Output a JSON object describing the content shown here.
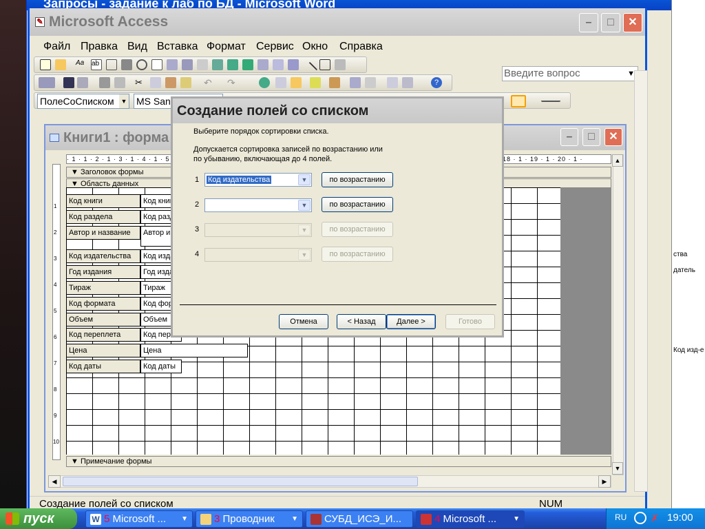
{
  "background_window": {
    "title": "Запросы - задание к лаб по БД - Microsoft Word"
  },
  "access": {
    "title": "Microsoft Access",
    "menu": [
      "Файл",
      "Правка",
      "Вид",
      "Вставка",
      "Формат",
      "Сервис",
      "Окно",
      "Справка"
    ],
    "help_placeholder": "Введите вопрос",
    "object_combo": "ПолеСоСписком",
    "font_combo": "MS Sans Serif",
    "status_text": "Создание полей со списком",
    "status_num": "NUM"
  },
  "form_window": {
    "title": "Книги1 : форма",
    "ruler_text": "· 1 · 1 · 2 · 1 · 3 · 1 · 4 · 1 · 5 · 1 · 6 · 1 · 7 · 1 · 8 · 1 · 9 · 1 · 10 · 1 · 11 · 1 · 12 · 1 · 13 · 1 · 14 · 1 · 15 · 1 · 16 · 1 · 17 · 1 · 18 · 1 · 19 · 1 · 20 · 1 ·",
    "header_section": "Заголовок формы",
    "detail_section": "Область данных",
    "footer_section": "Примечание формы",
    "fields": [
      {
        "label": "Код книги",
        "box": "Код книги"
      },
      {
        "label": "Код раздела",
        "box": "Код раздела"
      },
      {
        "label": "Автор и название",
        "box": "Автор и название"
      },
      {
        "label": "Код издательства",
        "box": "Код издательства"
      },
      {
        "label": "Год издания",
        "box": "Год издания"
      },
      {
        "label": "Тираж",
        "box": "Тираж"
      },
      {
        "label": "Код формата",
        "box": "Код формата"
      },
      {
        "label": "Объем",
        "box": "Объем"
      },
      {
        "label": "Код переплета",
        "box": "Код переплета"
      },
      {
        "label": "Цена",
        "box": "Цена"
      },
      {
        "label": "Код даты",
        "box": "Код даты"
      }
    ],
    "vruler_marks": [
      "1",
      "2",
      "3",
      "4",
      "5",
      "6",
      "7",
      "8",
      "9",
      "10"
    ]
  },
  "dialog": {
    "title": "Создание полей со списком",
    "instruction": "Выберите порядок сортировки списка.",
    "note_line1": "Допускается сортировка записей по возрастанию или",
    "note_line2": "по убыванию, включающая до 4 полей.",
    "rows": [
      {
        "num": "1",
        "value": "Код издательства",
        "order": "по возрастанию"
      },
      {
        "num": "2",
        "value": "",
        "order": "по возрастанию"
      },
      {
        "num": "3",
        "value": "",
        "order": "по возрастанию"
      },
      {
        "num": "4",
        "value": "",
        "order": "по возрастанию"
      }
    ],
    "buttons": {
      "cancel": "Отмена",
      "back": "< Назад",
      "next": "Далее >",
      "finish": "Готово"
    }
  },
  "right_doc": {
    "fragments": [
      "ства",
      "датель",
      "Код изд-е"
    ]
  },
  "taskbar": {
    "start_label": "пуск",
    "tasks": [
      {
        "num": "5",
        "label": "Microsoft ..."
      },
      {
        "num": "3",
        "label": "Проводник"
      },
      {
        "num": "",
        "label": "СУБД_ИСЭ_И..."
      },
      {
        "num": "4",
        "label": "Microsoft ..."
      }
    ],
    "lang": "RU",
    "clock": "19:00"
  }
}
